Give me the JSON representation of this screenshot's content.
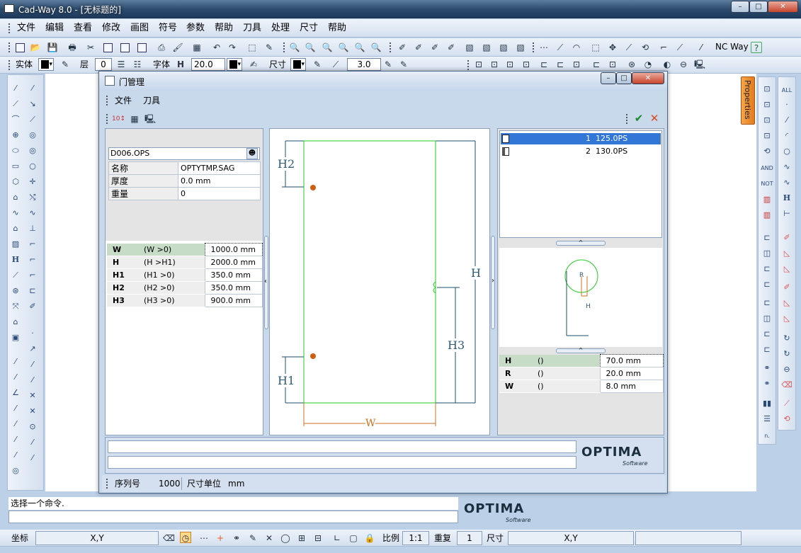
{
  "app": {
    "title": "Cad-Way 8.0 - [无标题的]"
  },
  "window_buttons": {
    "minimize": "–",
    "maximize": "□",
    "close": "✕"
  },
  "menu": [
    "文件",
    "编辑",
    "查看",
    "修改",
    "画图",
    "符号",
    "参数",
    "帮助",
    "刀具",
    "处理",
    "尺寸",
    "帮助"
  ],
  "toolbar": {
    "nc_way_label": "NC Way",
    "help_label": "?"
  },
  "propbar": {
    "entity_label": "实体",
    "layer_label": "层",
    "layer_value": "0",
    "font_label": "字体",
    "font_h_label": "H",
    "font_height": "20.0",
    "dim_label": "尺寸",
    "dim_value": "3.0"
  },
  "properties_tab": "Properties",
  "right_toolbar_labels": {
    "all": "ALL",
    "and": "AND",
    "not": "NOT"
  },
  "dialog": {
    "title": "门管理",
    "menu": [
      "文件",
      "刀具"
    ],
    "ok_icon": "✔",
    "cancel_icon": "✕",
    "file": "D006.OPS",
    "props": [
      {
        "label": "名称",
        "value": "OPTYTMP.SAG"
      },
      {
        "label": "厚度",
        "value": "0.0 mm"
      },
      {
        "label": "重量",
        "value": "0"
      }
    ],
    "params": [
      {
        "name": "W",
        "cond": "(W >0)",
        "value": "1000.0 mm"
      },
      {
        "name": "H",
        "cond": "(H >H1)",
        "value": "2000.0 mm"
      },
      {
        "name": "H1",
        "cond": "(H1 >0)",
        "value": "350.0 mm"
      },
      {
        "name": "H2",
        "cond": "(H2 >0)",
        "value": "350.0 mm"
      },
      {
        "name": "H3",
        "cond": "(H3 >0)",
        "value": "900.0 mm"
      }
    ],
    "drawing_labels": {
      "h2": "H2",
      "h1": "H1",
      "h": "H",
      "h3": "H3",
      "w": "W"
    },
    "list": [
      {
        "num": "1",
        "name": "125.0PS"
      },
      {
        "num": "2",
        "name": "130.0PS"
      }
    ],
    "preview_labels": {
      "r": "R",
      "h": "H"
    },
    "tool_params": [
      {
        "name": "H",
        "cond": "()",
        "value": "70.0 mm"
      },
      {
        "name": "R",
        "cond": "()",
        "value": "20.0 mm"
      },
      {
        "name": "W",
        "cond": "()",
        "value": "8.0 mm"
      }
    ],
    "logo": {
      "text": "OPTIMA",
      "sub": "Software"
    },
    "footer": {
      "serial_label": "序列号",
      "serial_value": "1000",
      "unit_label": "尺寸单位",
      "unit_value": "mm"
    }
  },
  "command": {
    "prompt": "选择一个命令."
  },
  "statusbar": {
    "coord_label": "坐标",
    "coord1": "X,Y",
    "scale_label": "比例",
    "scale_value": "1:1",
    "repeat_label": "重复",
    "repeat_value": "1",
    "dim_label": "尺寸",
    "coord2": "X,Y"
  }
}
